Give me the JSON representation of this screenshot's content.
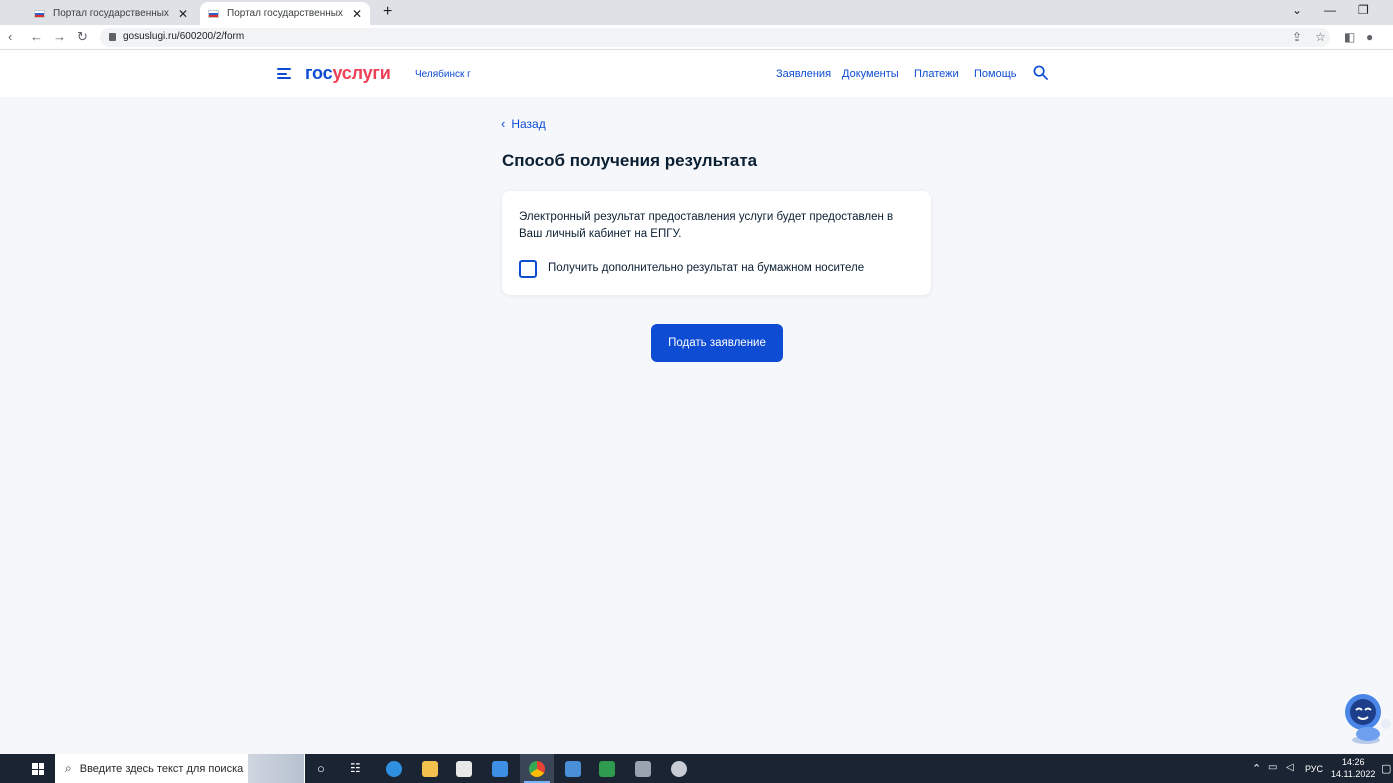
{
  "browser": {
    "tabs": [
      {
        "title": "Портал государственных услуг",
        "active": false
      },
      {
        "title": "Портал государственных услуг",
        "active": true
      }
    ],
    "new_tab": "+",
    "url": "gosuslugi.ru/600200/2/form"
  },
  "header": {
    "logo_part1": "гос",
    "logo_part2": "услуги",
    "city": "Челябинск г",
    "nav": [
      "Заявления",
      "Документы",
      "Платежи",
      "Помощь"
    ]
  },
  "content": {
    "back_label": "Назад",
    "title": "Способ получения результата",
    "info_text": "Электронный результат предоставления услуги будет предоставлен в Ваш личный кабинет на ЕПГУ.",
    "checkbox_label": "Получить дополнительно результат на бумажном носителе",
    "checkbox_checked": false,
    "submit_label": "Подать заявление"
  },
  "taskbar": {
    "search_placeholder": "Введите здесь текст для поиска",
    "lang": "РУС",
    "time": "14:26",
    "date": "14.11.2022"
  },
  "colors": {
    "brand_blue": "#0d4cd3",
    "brand_red": "#ee3f58",
    "page_bg": "#f5f7fa"
  }
}
